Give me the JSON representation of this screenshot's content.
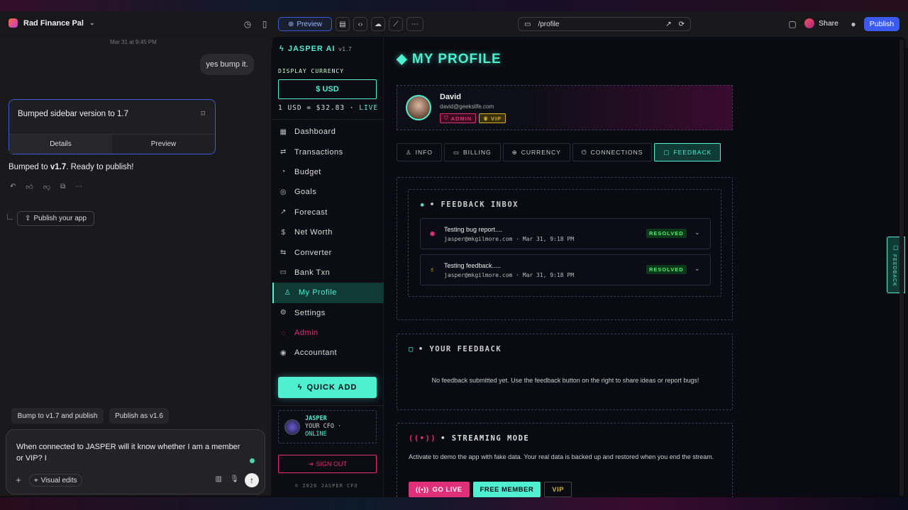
{
  "topbar": {
    "app_name": "Rad Finance Pal",
    "preview_label": "Preview",
    "url": "/profile",
    "share_label": "Share",
    "publish_label": "Publish"
  },
  "chat": {
    "timestamp": "Mar 31 at 9:45 PM",
    "user_message": "yes bump it.",
    "card_title": "Bumped sidebar version to 1.7",
    "card_tab_details": "Details",
    "card_tab_preview": "Preview",
    "bumped_prefix": "Bumped to ",
    "bumped_version": "v1.7",
    "bumped_suffix": ". Ready to publish!",
    "publish_app_label": "Publish your app",
    "suggestion_1": "Bump to v1.7 and publish",
    "suggestion_2": "Publish as v1.6",
    "input_text": "When connected to JASPER will it know whether I am a member or VIP? I",
    "visual_edits_label": "Visual edits"
  },
  "app": {
    "brand": "JASPER AI",
    "version": "v1.7",
    "display_currency_label": "DISPLAY CURRENCY",
    "currency_button": "$ USD",
    "rate_text": "1 USD = $32.83 · ",
    "rate_live": "LIVE",
    "nav": [
      {
        "label": "Dashboard",
        "icon": "▦"
      },
      {
        "label": "Transactions",
        "icon": "⇄"
      },
      {
        "label": "Budget",
        "icon": "◔"
      },
      {
        "label": "Goals",
        "icon": "◎"
      },
      {
        "label": "Forecast",
        "icon": "↗"
      },
      {
        "label": "Net Worth",
        "icon": "$"
      },
      {
        "label": "Converter",
        "icon": "⇆"
      },
      {
        "label": "Bank Txn",
        "icon": "▭"
      },
      {
        "label": "My Profile",
        "icon": "♙"
      },
      {
        "label": "Settings",
        "icon": "⚙"
      },
      {
        "label": "Admin",
        "icon": "◌"
      },
      {
        "label": "Accountant",
        "icon": "◉"
      }
    ],
    "quick_add_label": "QUICK ADD",
    "jasper_name": "JASPER",
    "jasper_role": "YOUR CFO ·",
    "jasper_status": "ONLINE",
    "sign_out_label": "SIGN OUT",
    "copyright": "© 2026 JASPER CFO"
  },
  "profile": {
    "title": "◆ MY PROFILE",
    "name": "David",
    "email": "david@geekslife.com",
    "badge_admin": "ADMIN",
    "badge_vip": "VIP",
    "tabs": [
      "INFO",
      "BILLING",
      "CURRENCY",
      "CONNECTIONS",
      "FEEDBACK"
    ],
    "tab_icons": [
      "♙",
      "▭",
      "⊕",
      "⏻",
      "▢"
    ],
    "inbox_title": "• FEEDBACK INBOX",
    "feedback_items": [
      {
        "title": "Testing bug report....",
        "meta": "jasper@mkgilmore.com · Mar 31, 9:18 PM",
        "status": "RESOLVED",
        "icon": "✹",
        "icon_color": "#e0307a"
      },
      {
        "title": "Testing feedback.....",
        "meta": "jasper@mkgilmore.com · Mar 31, 9:18 PM",
        "status": "RESOLVED",
        "icon": "💡",
        "icon_color": "#d4b020"
      }
    ],
    "your_feedback_title": "• YOUR FEEDBACK",
    "your_feedback_empty": "No feedback submitted yet. Use the feedback button on the right to share ideas or report bugs!",
    "streaming_title": "• STREAMING MODE",
    "streaming_desc": "Activate to demo the app with fake data. Your real data is backed up and restored when you end the stream.",
    "go_live_label": "GO LIVE",
    "free_member_label": "FREE MEMBER",
    "vip_label": "VIP",
    "feedback_side_tab": "FEEDBACK"
  },
  "colors": {
    "accent": "#4ef0d0",
    "admin": "#e0307a",
    "vip": "#d4b020",
    "publish": "#3b5bf0"
  }
}
